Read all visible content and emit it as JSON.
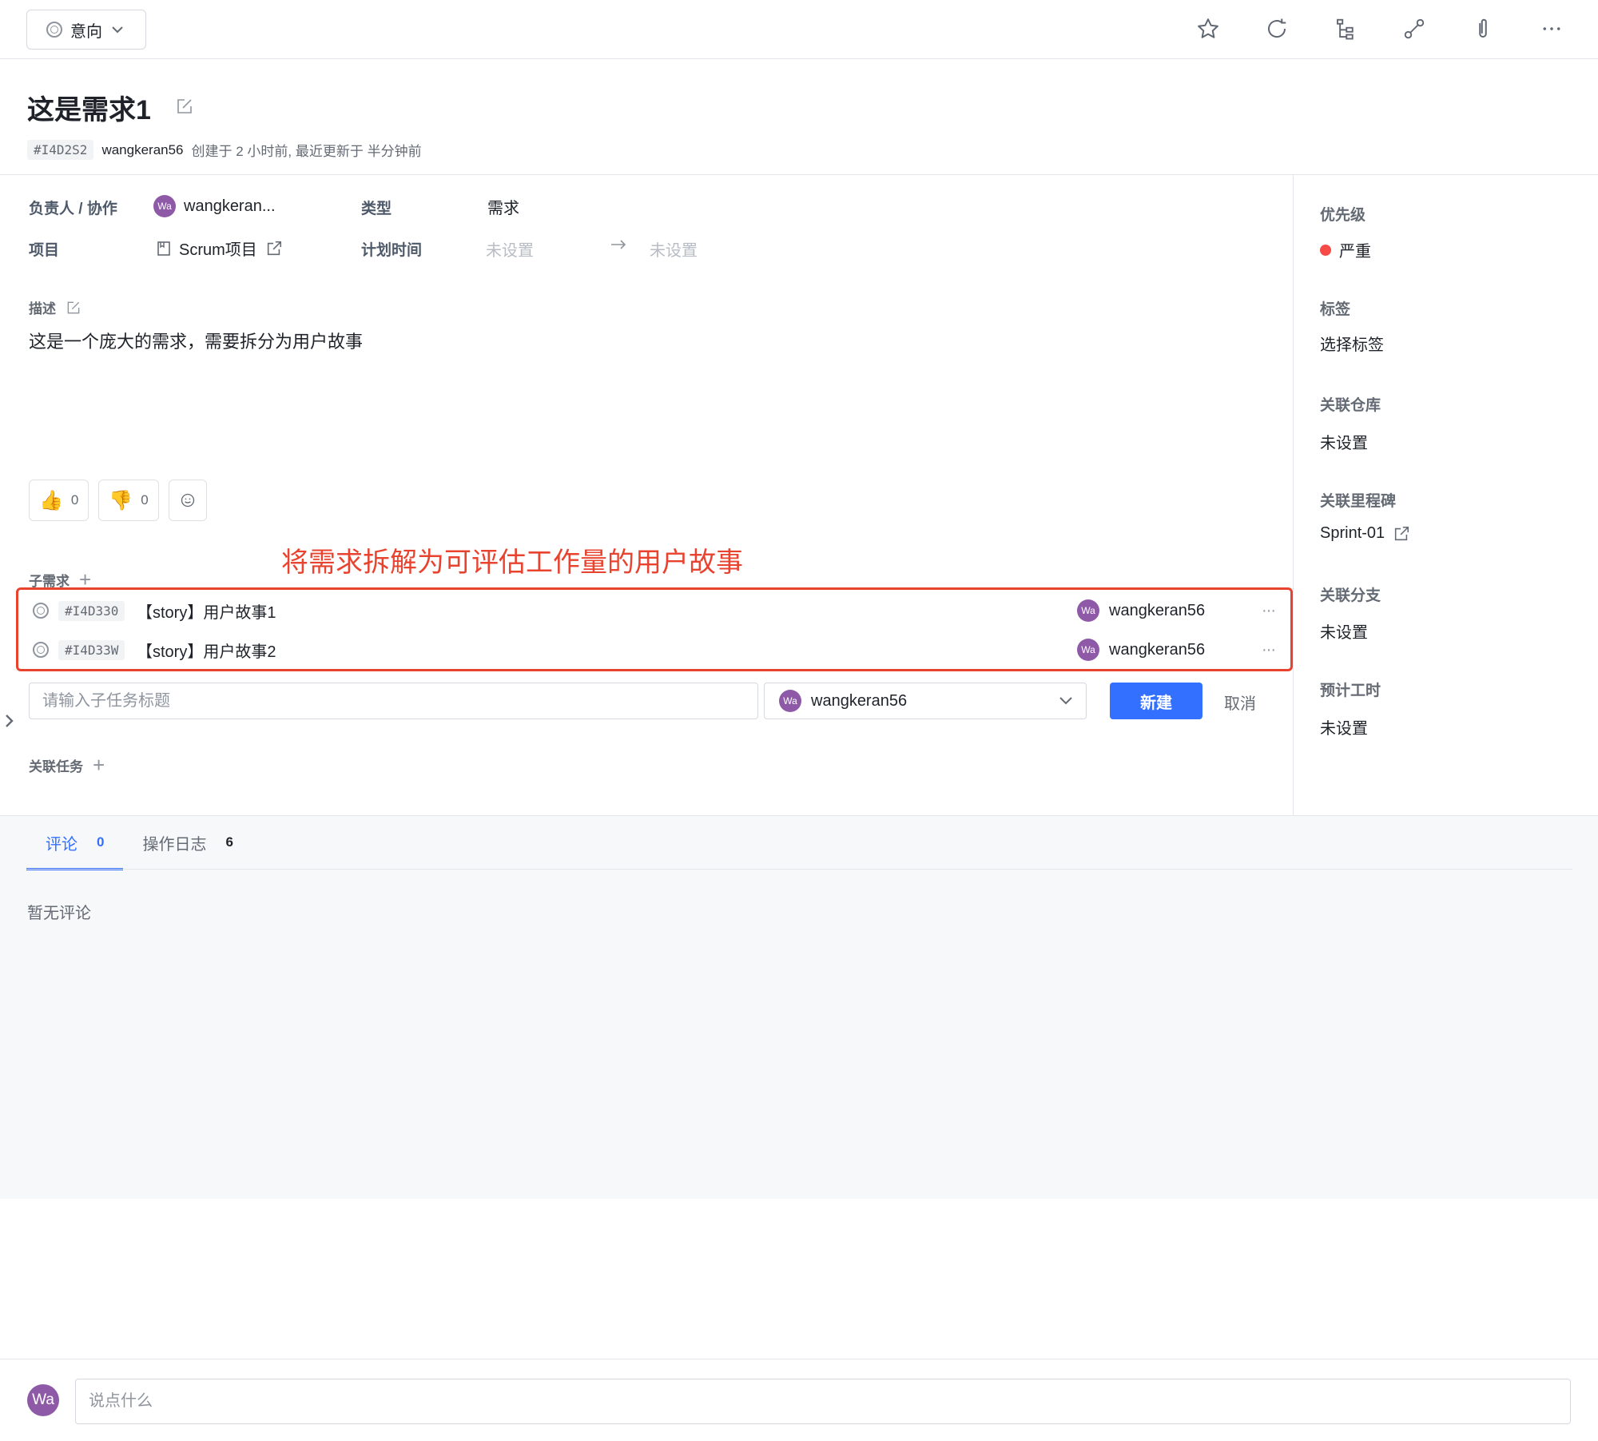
{
  "topbar": {
    "status_label": "意向",
    "icons": [
      "star-icon",
      "refresh-icon",
      "hierarchy-icon",
      "link-icon",
      "attachment-icon",
      "more-icon"
    ]
  },
  "header": {
    "title": "这是需求1",
    "id": "#I4D2S2",
    "creator": "wangkeran56",
    "meta_text": "创建于 2 小时前, 最近更新于 半分钟前"
  },
  "fields": {
    "assignee_label": "负责人 / 协作",
    "assignee_avatar": "Wa",
    "assignee_value": "wangkeran...",
    "type_label": "类型",
    "type_value": "需求",
    "project_label": "项目",
    "project_value": "Scrum项目",
    "plan_time_label": "计划时间",
    "plan_start": "未设置",
    "plan_end": "未设置"
  },
  "description": {
    "label": "描述",
    "text": "这是一个庞大的需求，需要拆分为用户故事"
  },
  "reactions": {
    "like_count": "0",
    "dislike_count": "0"
  },
  "annotation": "将需求拆解为可评估工作量的用户故事",
  "subtasks": {
    "label": "子需求",
    "items": [
      {
        "id": "#I4D330",
        "title": "【story】用户故事1",
        "assignee_avatar": "Wa",
        "assignee": "wangkeran56"
      },
      {
        "id": "#I4D33W",
        "title": "【story】用户故事2",
        "assignee_avatar": "Wa",
        "assignee": "wangkeran56"
      }
    ],
    "new_placeholder": "请输入子任务标题",
    "new_assignee_avatar": "Wa",
    "new_assignee": "wangkeran56",
    "create_label": "新建",
    "cancel_label": "取消"
  },
  "related_tasks_label": "关联任务",
  "sidebar": {
    "priority_label": "优先级",
    "priority_value": "严重",
    "priority_color": "#f54a45",
    "tags_label": "标签",
    "tags_placeholder": "选择标签",
    "repo_label": "关联仓库",
    "repo_value": "未设置",
    "milestone_label": "关联里程碑",
    "milestone_value": "Sprint-01",
    "branch_label": "关联分支",
    "branch_value": "未设置",
    "estimate_label": "预计工时",
    "estimate_value": "未设置"
  },
  "tabs": [
    {
      "label": "评论",
      "count": "0"
    },
    {
      "label": "操作日志",
      "count": "6"
    }
  ],
  "comments": {
    "empty_text": "暂无评论",
    "avatar": "Wa",
    "input_placeholder": "说点什么"
  },
  "colors": {
    "accent": "#3370ff",
    "annotation": "#e8432f",
    "avatar": "#8e5aa7"
  }
}
